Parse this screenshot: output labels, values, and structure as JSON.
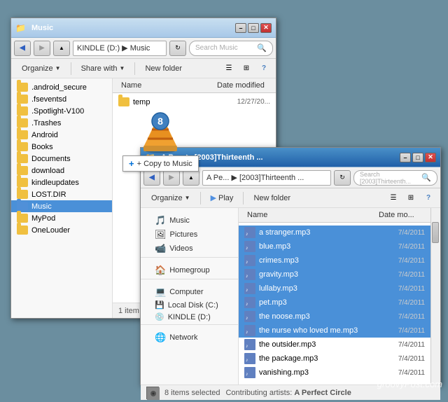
{
  "window1": {
    "title": "Music",
    "address": "KINDLE (D:) ▶ Music",
    "search_placeholder": "Search Music",
    "toolbar": {
      "organize": "Organize",
      "share": "Share with",
      "new_folder": "New folder"
    },
    "sidebar": {
      "favorites": [],
      "libraries": [
        {
          "label": "Music",
          "icon": "music"
        },
        {
          "label": "Pictures",
          "icon": "pictures"
        },
        {
          "label": "Videos",
          "icon": "videos"
        }
      ],
      "homegroup": "Homegroup",
      "computer": "Computer",
      "local_disk": "Local Disk (C:)",
      "kindle": "KINDLE (D:)",
      "network": "Network"
    },
    "files": [
      {
        "name": "temp",
        "date": "",
        "type": "folder"
      }
    ],
    "status": "1 item",
    "folders_left": [
      ".android_secure",
      ".fseventsd",
      ".Spotlight-V100",
      ".Trashes",
      "Android",
      "Books",
      "Documents",
      "download",
      "kindleupdates",
      "LOST.DIR",
      "Music",
      "MyPod",
      "OneLouder"
    ]
  },
  "window2": {
    "title": "A Pe... ▶ [2003]Thirteenth ...",
    "address": "A Pe... ▶ [2003]Thirteenth ...",
    "search_placeholder": "Search [2003]Thirteenth...",
    "toolbar": {
      "organize": "Organize",
      "play": "Play",
      "new_folder": "New folder"
    },
    "columns": {
      "name": "Name",
      "date": "Date mo..."
    },
    "files": [
      {
        "name": "a stranger.mp3",
        "date": "7/4/2011"
      },
      {
        "name": "blue.mp3",
        "date": "7/4/2011"
      },
      {
        "name": "crimes.mp3",
        "date": "7/4/2011"
      },
      {
        "name": "gravity.mp3",
        "date": "7/4/2011"
      },
      {
        "name": "lullaby.mp3",
        "date": "7/4/2011"
      },
      {
        "name": "pet.mp3",
        "date": "7/4/2011"
      },
      {
        "name": "the noose.mp3",
        "date": "7/4/2011"
      },
      {
        "name": "the nurse who loved me.mp3",
        "date": "7/4/2011"
      },
      {
        "name": "the outsider.mp3",
        "date": "7/4/2011"
      },
      {
        "name": "the package.mp3",
        "date": "7/4/2011"
      },
      {
        "name": "vanishing.mp3",
        "date": "7/4/2011"
      }
    ],
    "status": {
      "count": "8 items selected",
      "artist_label": "Contributing artists:",
      "artist": "A Perfect Circle"
    }
  },
  "tooltip": {
    "label": "+ Copy to Music"
  },
  "watermark": "groovyPost.com"
}
